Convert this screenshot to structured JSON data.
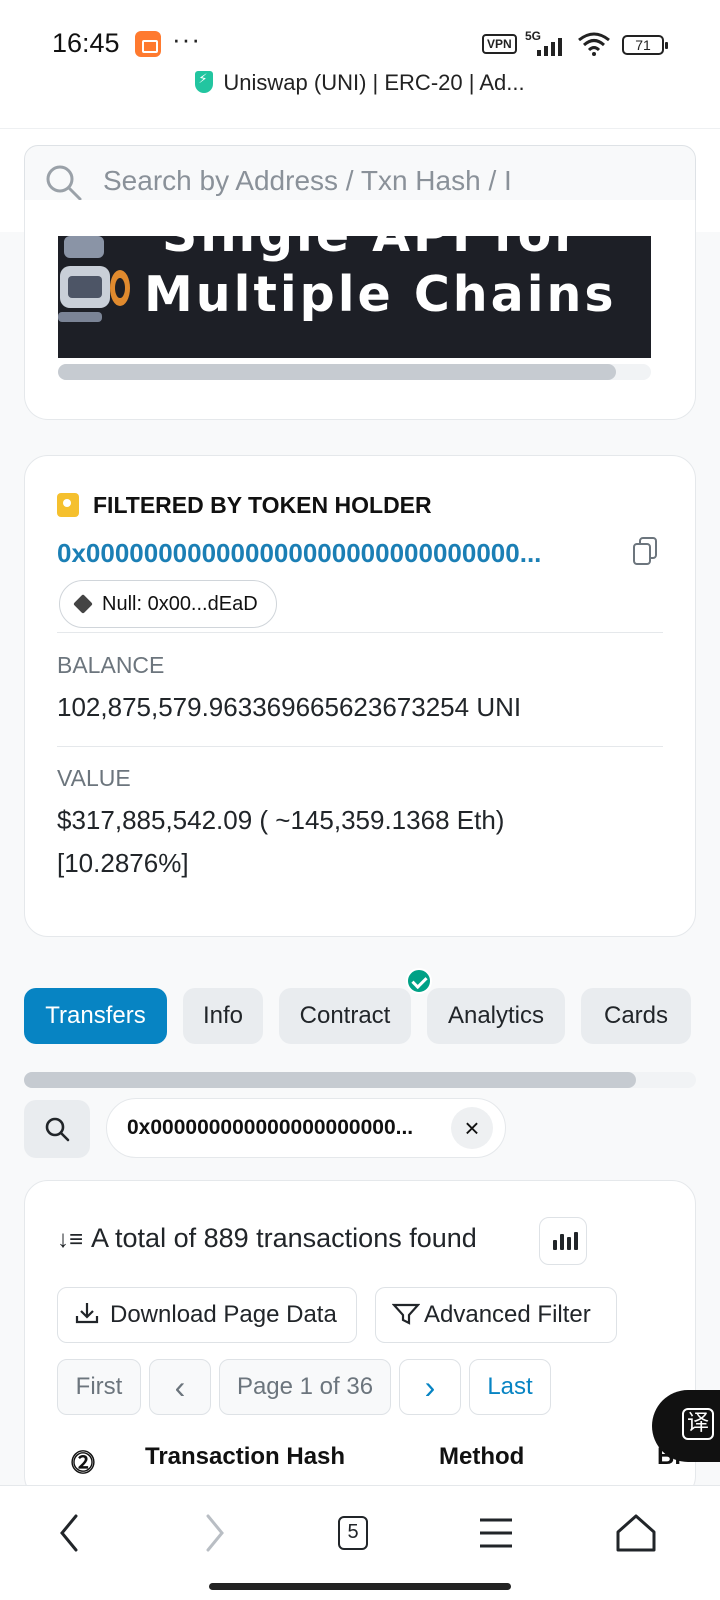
{
  "status_bar": {
    "time": "16:45",
    "dots": "···",
    "vpn": "VPN",
    "network": "5G",
    "battery": "71"
  },
  "browser": {
    "page_title": "Uniswap (UNI) | ERC-20 | Ad...",
    "tabs_count": "5"
  },
  "search": {
    "placeholder": "Search by Address / Txn Hash / I"
  },
  "banner": {
    "text_top": "Single API for",
    "text_bottom": "Multiple Chains"
  },
  "holder": {
    "title": "FILTERED BY TOKEN HOLDER",
    "address": "0x000000000000000000000000000000...",
    "name_tag": "Null: 0x00...dEaD",
    "balance_label": "BALANCE",
    "balance_value": "102,875,579.963369665623673254 UNI",
    "value_label": "VALUE",
    "value_line1": "$317,885,542.09 ( ~145,359.1368 Eth)",
    "value_line2": "[10.2876%]"
  },
  "tabs": [
    {
      "label": "Transfers",
      "active": true
    },
    {
      "label": "Info",
      "active": false
    },
    {
      "label": "Contract",
      "active": false,
      "verified": true
    },
    {
      "label": "Analytics",
      "active": false
    },
    {
      "label": "Cards",
      "active": false
    }
  ],
  "filter": {
    "address_chip": "0x000000000000000000000...",
    "clear": "×"
  },
  "transactions": {
    "total_text": "A total of 889 transactions found",
    "download_label": "Download Page Data",
    "advanced_filter_label": "Advanced Filter",
    "pagination": {
      "first": "First",
      "prev": "‹",
      "page_text": "Page 1 of 36",
      "next": "›",
      "last": "Last"
    },
    "columns": [
      "Transaction Hash",
      "Method",
      "Bl"
    ]
  },
  "translate_button": "译",
  "colors": {
    "accent": "#0784c3",
    "link": "#1b7fb5",
    "verified": "#00a186",
    "tag": "#f5c02e"
  }
}
